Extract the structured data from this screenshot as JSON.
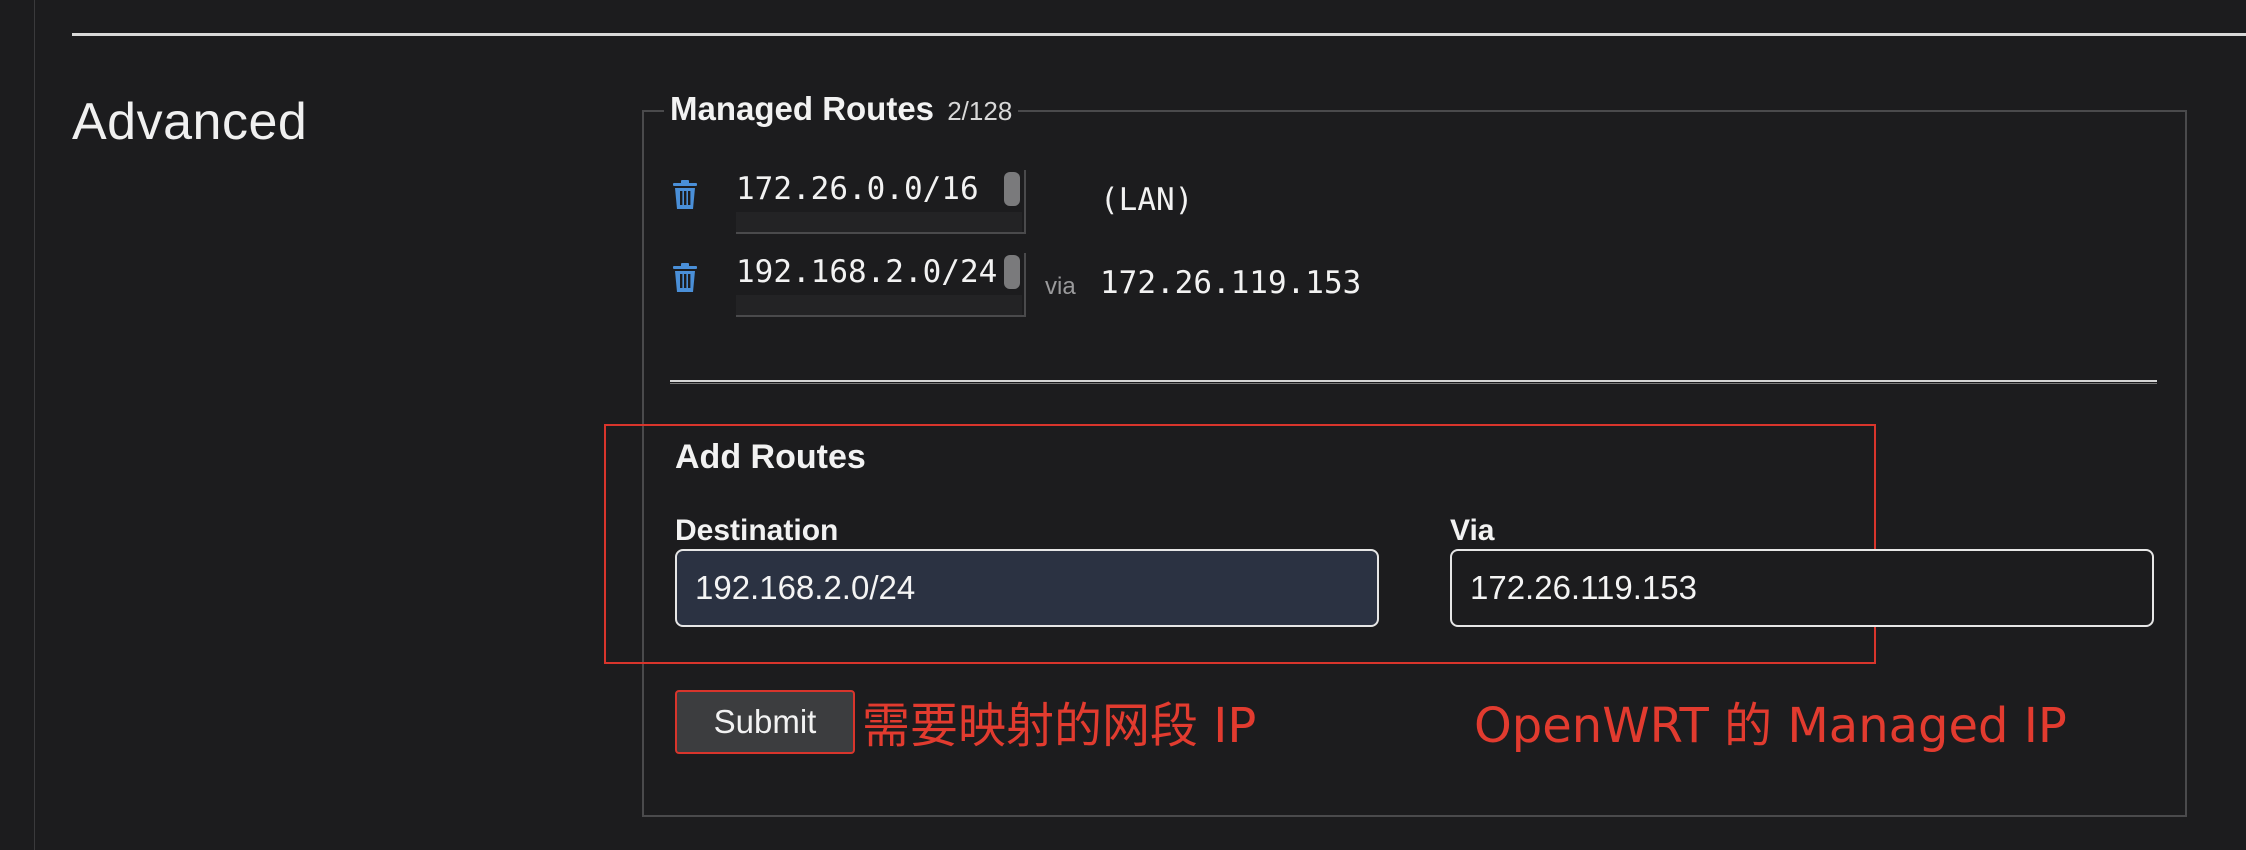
{
  "section": {
    "title": "Advanced"
  },
  "managed_routes": {
    "legend": "Managed Routes",
    "count": "2/128",
    "routes": [
      {
        "destination": "172.26.0.0/16",
        "via_label": "",
        "target": "(LAN)"
      },
      {
        "destination": "192.168.2.0/24",
        "via_label": "via",
        "target": "172.26.119.153"
      }
    ]
  },
  "add_routes": {
    "title": "Add Routes",
    "destination_label": "Destination",
    "destination_value": "192.168.2.0/24",
    "via_label": "Via",
    "via_value": "172.26.119.153",
    "submit_label": "Submit"
  },
  "annotations": {
    "left": "需要映射的网段 IP",
    "right": "OpenWRT 的 Managed IP"
  },
  "colors": {
    "background": "#1c1c1e",
    "trash_icon": "#4a8fd8",
    "annotation": "#e23b2f",
    "destination_field": "#2b3242"
  }
}
